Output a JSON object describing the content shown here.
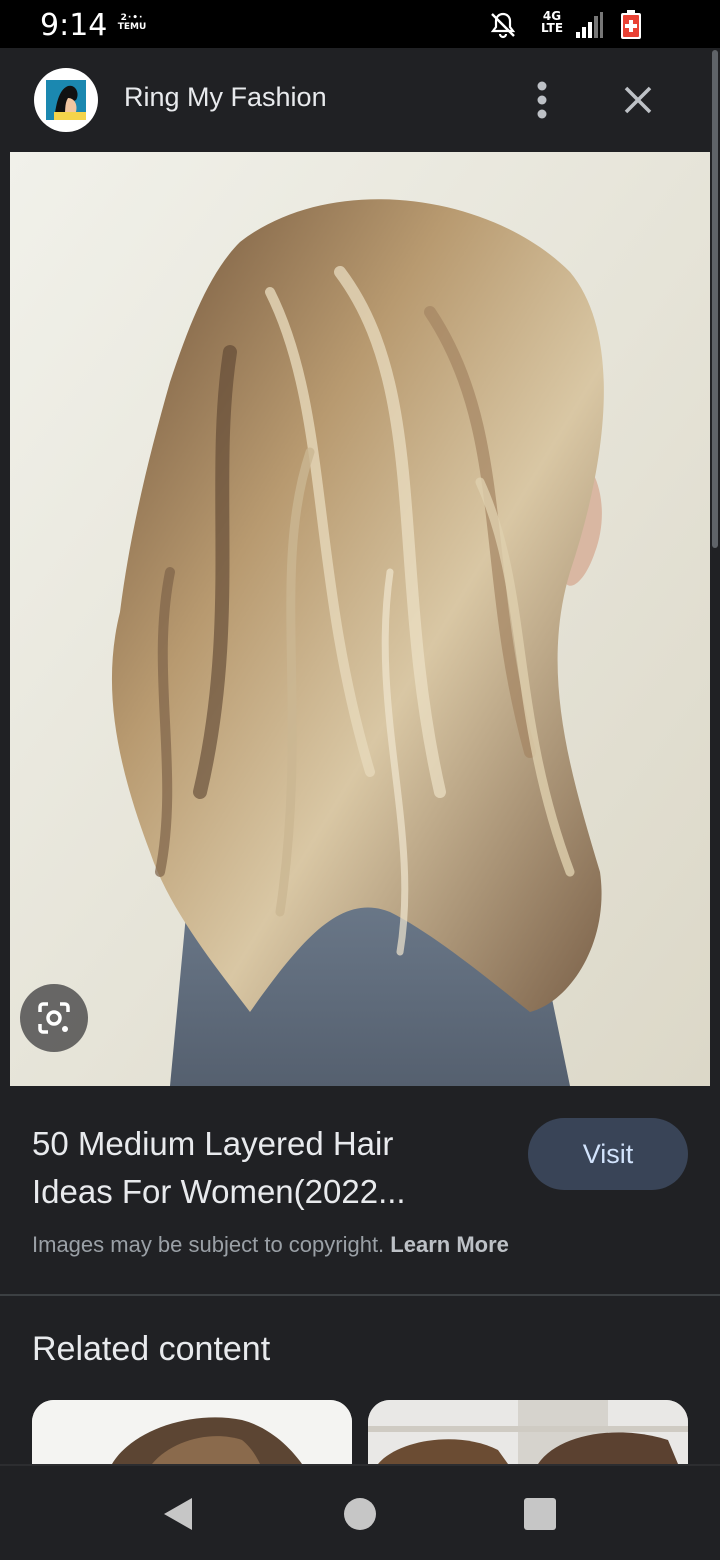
{
  "status_bar": {
    "time": "9:14",
    "app_indicator_top": "2·•·",
    "app_indicator_label": "TEMU",
    "network_top": "4G",
    "network_bottom": "LTE"
  },
  "header": {
    "site_name": "Ring My Fashion",
    "icons": [
      "site-favicon",
      "more-vert-icon",
      "close-icon"
    ]
  },
  "image": {
    "description_icon": "lens-icon"
  },
  "info": {
    "title_line1": "50 Medium Layered Hair",
    "title_line2": "Ideas For Women(2022...",
    "visit_label": "Visit",
    "copyright_text": "Images may be subject to copyright.",
    "learn_more_label": "Learn More"
  },
  "related": {
    "title": "Related content"
  },
  "nav": {
    "icons": [
      "back-icon",
      "home-icon",
      "recents-icon"
    ]
  },
  "colors": {
    "background": "#202124",
    "visit_button": "#394457",
    "visit_text": "#d2e3fc",
    "secondary_text": "#9aa0a6"
  }
}
